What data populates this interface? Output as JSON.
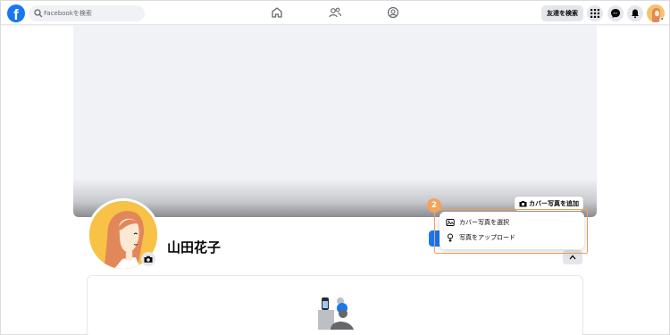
{
  "header": {
    "logo_letter": "f",
    "search": {
      "placeholder": "Facebookを検索"
    },
    "nav_icons": [
      "home-icon",
      "friends-icon",
      "profile-icon"
    ],
    "find_friends_label": "友達を検索",
    "right_icons": [
      "menu-grid-icon",
      "messenger-icon",
      "notifications-icon",
      "account-avatar"
    ]
  },
  "cover": {
    "add_cover_label": "カバー写真を追加"
  },
  "profile": {
    "name": "山田花子"
  },
  "dropdown": {
    "step_number": "2",
    "items": [
      {
        "label": "カバー写真を選択",
        "icon": "image-select-icon"
      },
      {
        "label": "写真をアップロード",
        "icon": "upload-icon"
      }
    ]
  },
  "colors": {
    "brand_blue": "#1877f2",
    "highlight_orange": "#f5a25a",
    "background_gray": "#f0f2f5"
  }
}
